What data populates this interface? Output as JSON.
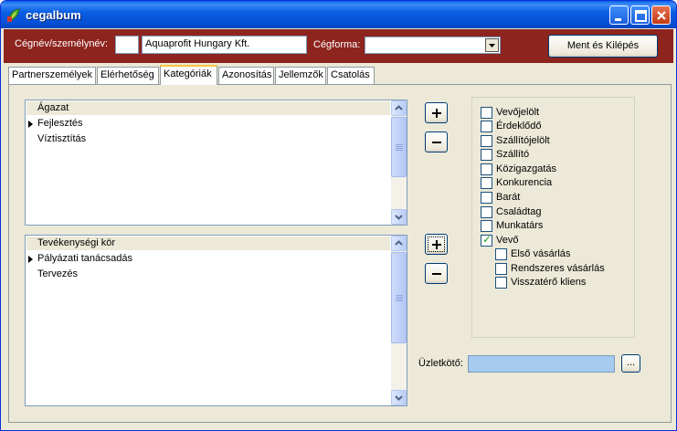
{
  "window": {
    "title": "cegalbum",
    "colors": {
      "titlebar": "#0b5fe3",
      "header": "#8d241e",
      "face": "#ece9d8",
      "ugyfel_field": "#a6caf0"
    }
  },
  "header": {
    "cegnev_label": "Cégnév/személynév:",
    "short_code_value": "",
    "cegnev_value": "Aquaprofit Hungary Kft.",
    "cegforma_label": "Cégforma:",
    "cegforma_value": "",
    "save_exit_label": "Ment és Kilépés"
  },
  "tabs": [
    {
      "label": "Partnerszemélyek",
      "active": false
    },
    {
      "label": "Elérhetőség",
      "active": false
    },
    {
      "label": "Kategóriák",
      "active": true
    },
    {
      "label": "Azonosítás",
      "active": false
    },
    {
      "label": "Jellemzők",
      "active": false
    },
    {
      "label": "Csatolás",
      "active": false
    }
  ],
  "agazat_list": {
    "header": "Ágazat",
    "rows": [
      {
        "text": "Fejlesztés",
        "current": true
      },
      {
        "text": "Víztisztítás",
        "current": false
      }
    ]
  },
  "tevekenyseg_list": {
    "header": "Tevékenységi kör",
    "rows": [
      {
        "text": "Pályázati tanácsadás",
        "current": true
      },
      {
        "text": "Tervezés",
        "current": false
      }
    ]
  },
  "buttons": {
    "add_icon": "plus-icon",
    "remove_icon": "minus-icon"
  },
  "categories": [
    {
      "label": "Vevőjelölt",
      "checked": false,
      "level": 0
    },
    {
      "label": "Érdeklődő",
      "checked": false,
      "level": 0
    },
    {
      "label": "Szállítójelölt",
      "checked": false,
      "level": 0
    },
    {
      "label": "Szállító",
      "checked": false,
      "level": 0
    },
    {
      "label": "Közigazgatás",
      "checked": false,
      "level": 0
    },
    {
      "label": "Konkurencia",
      "checked": false,
      "level": 0
    },
    {
      "label": "Barát",
      "checked": false,
      "level": 0
    },
    {
      "label": "Családtag",
      "checked": false,
      "level": 0
    },
    {
      "label": "Munkatárs",
      "checked": false,
      "level": 0
    },
    {
      "label": "Vevő",
      "checked": true,
      "level": 0
    },
    {
      "label": "Első vásárlás",
      "checked": false,
      "level": 1
    },
    {
      "label": "Rendszeres vásárlás",
      "checked": false,
      "level": 1
    },
    {
      "label": "Visszatérő kliens",
      "checked": false,
      "level": 1
    }
  ],
  "uzletkoto": {
    "label": "Üzletkötő:",
    "value": "",
    "browse_label": "..."
  }
}
